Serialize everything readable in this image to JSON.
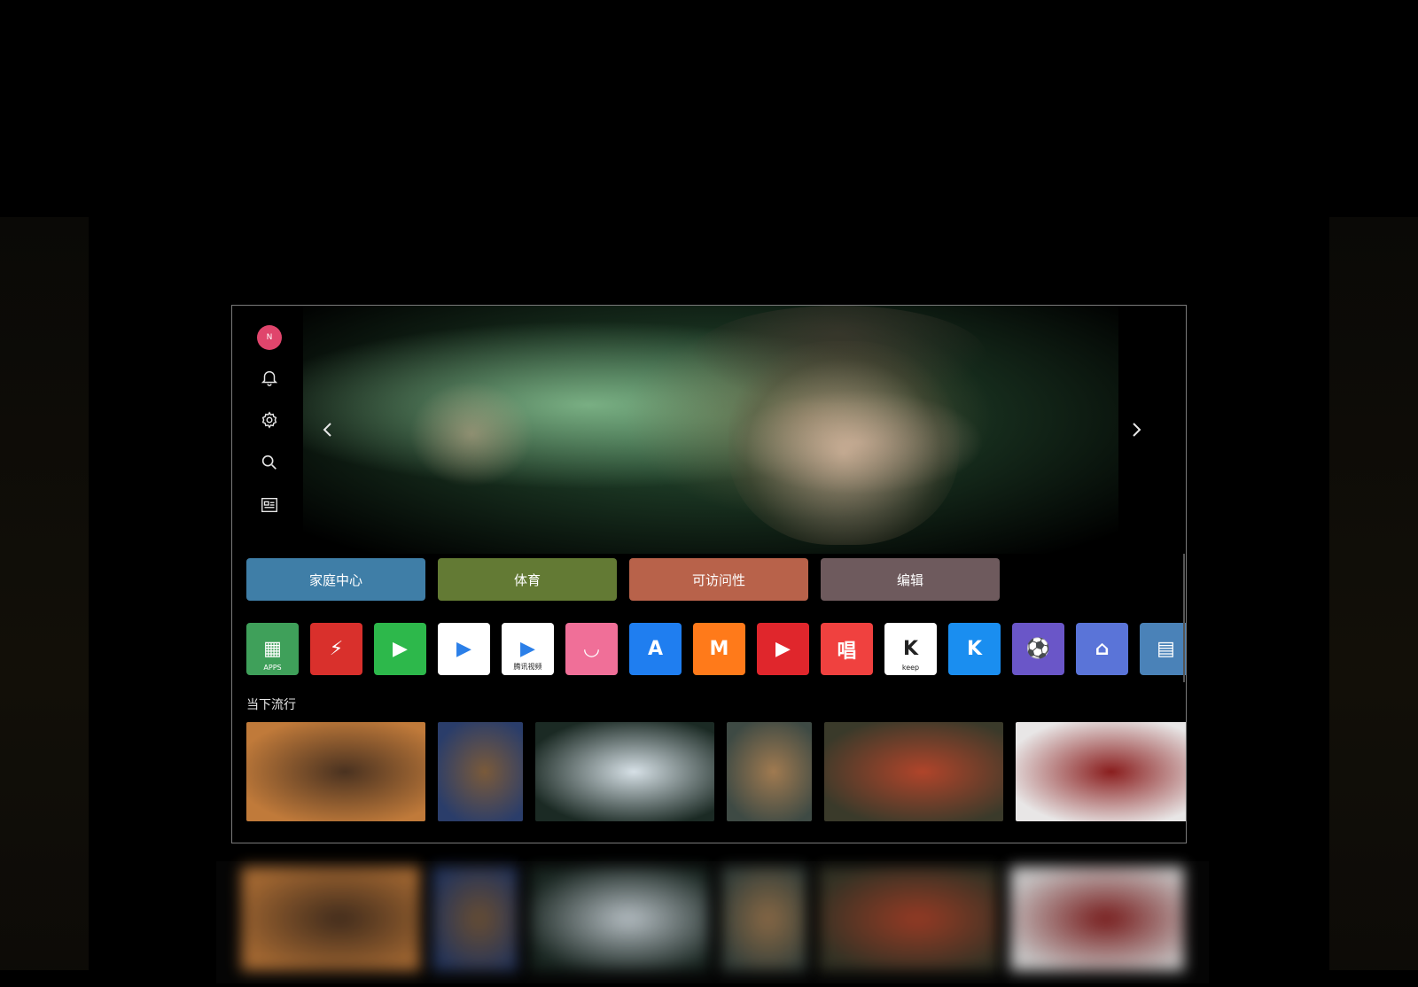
{
  "sidebar": {
    "avatar_initial": "N",
    "icons": [
      "bell-icon",
      "gear-icon",
      "search-icon",
      "guide-icon"
    ]
  },
  "hero": {
    "prev_icon": "chevron-left-icon",
    "next_icon": "chevron-right-icon"
  },
  "categories": [
    {
      "label": "家庭中心",
      "color": "#3f7ea7"
    },
    {
      "label": "体育",
      "color": "#637a34"
    },
    {
      "label": "可访问性",
      "color": "#b8624a"
    },
    {
      "label": "编辑",
      "color": "#6e5a5d"
    }
  ],
  "apps": [
    {
      "name": "APPS",
      "glyph": "▦",
      "bg": "#3fa05a"
    },
    {
      "name": "sports-app",
      "glyph": "⚡",
      "bg": "#d9302c"
    },
    {
      "name": "tv-app",
      "glyph": "▶",
      "bg": "#2db84b"
    },
    {
      "name": "youku-app",
      "glyph": "▶",
      "bg": "#ffffff"
    },
    {
      "name": "腾讯视频",
      "glyph": "▶",
      "bg": "#ffffff"
    },
    {
      "name": "bilibili-app",
      "glyph": "◡",
      "bg": "#f06f98"
    },
    {
      "name": "appstore-app",
      "glyph": "A",
      "bg": "#1f7ef0"
    },
    {
      "name": "mango-tv-app",
      "glyph": "M",
      "bg": "#ff7a1a"
    },
    {
      "name": "video-app",
      "glyph": "▶",
      "bg": "#e0262c"
    },
    {
      "name": "唱",
      "glyph": "唱",
      "bg": "#f0413f"
    },
    {
      "name": "keep",
      "glyph": "K",
      "bg": "#ffffff"
    },
    {
      "name": "K歌",
      "glyph": "K",
      "bg": "#1a8ef0"
    },
    {
      "name": "sports-club-app",
      "glyph": "⚽",
      "bg": "#6a56c8"
    },
    {
      "name": "home-app",
      "glyph": "⌂",
      "bg": "#5a74d8"
    },
    {
      "name": "map-app",
      "glyph": "▤",
      "bg": "#4a82b8"
    }
  ],
  "trending": {
    "title": "当下流行",
    "colors": [
      [
        "#c07a3a",
        "#4a3220"
      ],
      [
        "#2a3d6a",
        "#7a5a3a"
      ],
      [
        "#1b2a24",
        "#d6e0e6"
      ],
      [
        "#3e4a44",
        "#a07a50"
      ],
      [
        "#3a3a2a",
        "#b0442a"
      ],
      [
        "#e8e6e6",
        "#8a1e1e"
      ]
    ]
  }
}
